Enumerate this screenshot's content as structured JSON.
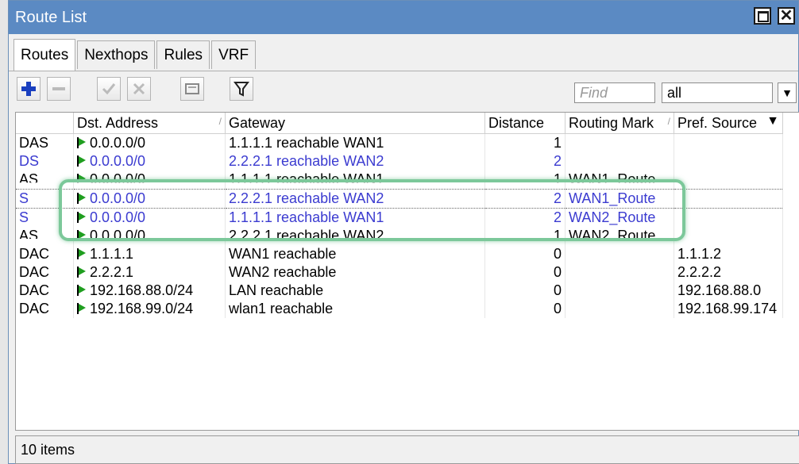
{
  "window": {
    "title": "Route List"
  },
  "tabs": [
    {
      "label": "Routes"
    },
    {
      "label": "Nexthops"
    },
    {
      "label": "Rules"
    },
    {
      "label": "VRF"
    }
  ],
  "toolbar": {
    "find_placeholder": "Find",
    "filter_value": "all",
    "icons": [
      "add-icon",
      "remove-icon",
      "enable-icon",
      "disable-icon",
      "comment-icon",
      "filter-icon"
    ]
  },
  "table": {
    "columns": [
      "",
      "Dst. Address",
      "Gateway",
      "Distance",
      "Routing Mark",
      "Pref. Source"
    ],
    "rows": [
      {
        "flags": "DAS",
        "dst": "0.0.0.0/0",
        "gateway": "1.1.1.1 reachable WAN1",
        "distance": "1",
        "mark": "",
        "pref": "",
        "style": "normal"
      },
      {
        "flags": "DS",
        "dst": "0.0.0.0/0",
        "gateway": "2.2.2.1 reachable WAN2",
        "distance": "2",
        "mark": "",
        "pref": "",
        "style": "blue"
      },
      {
        "flags": "AS",
        "dst": "0.0.0.0/0",
        "gateway": "1.1.1.1 reachable WAN1",
        "distance": "1",
        "mark": "WAN1_Route",
        "pref": "",
        "style": "partial"
      },
      {
        "flags": "S",
        "dst": "0.0.0.0/0",
        "gateway": "2.2.2.1 reachable WAN2",
        "distance": "2",
        "mark": "WAN1_Route",
        "pref": "",
        "style": "blue"
      },
      {
        "flags": "S",
        "dst": "0.0.0.0/0",
        "gateway": "1.1.1.1 reachable WAN1",
        "distance": "2",
        "mark": "WAN2_Route",
        "pref": "",
        "style": "blue"
      },
      {
        "flags": "AS",
        "dst": "0.0.0.0/0",
        "gateway": "2.2.2.1 reachable WAN2",
        "distance": "1",
        "mark": "WAN2_Route",
        "pref": "",
        "style": "partial"
      },
      {
        "flags": "DAC",
        "dst": "1.1.1.1",
        "gateway": "WAN1 reachable",
        "distance": "0",
        "mark": "",
        "pref": "1.1.1.2",
        "style": "normal"
      },
      {
        "flags": "DAC",
        "dst": "2.2.2.1",
        "gateway": "WAN2 reachable",
        "distance": "0",
        "mark": "",
        "pref": "2.2.2.2",
        "style": "normal"
      },
      {
        "flags": "DAC",
        "dst": "192.168.88.0/24",
        "gateway": "LAN reachable",
        "distance": "0",
        "mark": "",
        "pref": "192.168.88.0",
        "style": "normal"
      },
      {
        "flags": "DAC",
        "dst": "192.168.99.0/24",
        "gateway": "wlan1 reachable",
        "distance": "0",
        "mark": "",
        "pref": "192.168.99.174",
        "style": "normal"
      }
    ]
  },
  "status": {
    "items": "10 items"
  },
  "colors": {
    "title_bar": "#5b8ac3",
    "blue_text": "#3b3bd0",
    "flag_green": "#1f9e1f",
    "highlight": "#7cc89a"
  }
}
